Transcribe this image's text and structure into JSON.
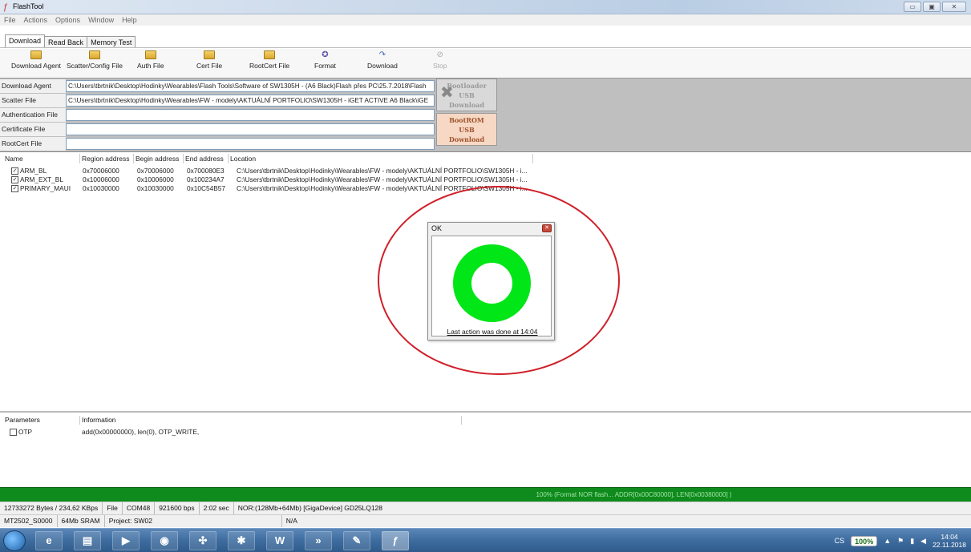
{
  "window": {
    "title": "FlashTool"
  },
  "menu": [
    "File",
    "Actions",
    "Options",
    "Window",
    "Help"
  ],
  "tabs": [
    "Download",
    "Read Back",
    "Memory Test"
  ],
  "toolbar": {
    "download_agent": "Download Agent",
    "scatter": "Scatter/Config File",
    "auth": "Auth File",
    "cert": "Cert File",
    "rootcert": "RootCert File",
    "format": "Format",
    "download": "Download",
    "stop": "Stop"
  },
  "files": {
    "download_agent_label": "Download Agent",
    "download_agent_value": "C:\\Users\\tbrtnik\\Desktop\\Hodinky\\Wearables\\Flash Tools\\Software of SW1305H - (A6 Black)Flash přes PC\\25.7.2018\\Flash",
    "scatter_label": "Scatter File",
    "scatter_value": "C:\\Users\\tbrtnik\\Desktop\\Hodinky\\Wearables\\FW - modely\\AKTUÁLNÍ PORTFOLIO\\SW1305H - iGET ACTIVE A6 Black\\iGE",
    "auth_label": "Authentication File",
    "auth_value": "",
    "cert_label": "Certificate File",
    "cert_value": "",
    "rootcert_label": "RootCert File",
    "rootcert_value": ""
  },
  "modes": {
    "bootloader": [
      "Bootloader",
      "USB",
      "Download"
    ],
    "bootrom": [
      "BootROM",
      "USB",
      "Download"
    ]
  },
  "region_table": {
    "headers": [
      "Name",
      "Region address",
      "Begin address",
      "End address",
      "Location"
    ],
    "rows": [
      {
        "name": "ARM_BL",
        "region": "0x70006000",
        "begin": "0x70006000",
        "end": "0x700080E3",
        "location": "C:\\Users\\tbrtnik\\Desktop\\Hodinky\\Wearables\\FW - modely\\AKTUÁLNÍ PORTFOLIO\\SW1305H - i..."
      },
      {
        "name": "ARM_EXT_BL",
        "region": "0x10006000",
        "begin": "0x10006000",
        "end": "0x100234A7",
        "location": "C:\\Users\\tbrtnik\\Desktop\\Hodinky\\Wearables\\FW - modely\\AKTUÁLNÍ PORTFOLIO\\SW1305H - i..."
      },
      {
        "name": "PRIMARY_MAUI",
        "region": "0x10030000",
        "begin": "0x10030000",
        "end": "0x10C54B57",
        "location": "C:\\Users\\tbrtnik\\Desktop\\Hodinky\\Wearables\\FW - modely\\AKTUÁLNÍ PORTFOLIO\\SW1305H - i..."
      }
    ]
  },
  "dialog": {
    "title": "OK",
    "message": "Last action was done at 14:04",
    "ring_color": "#00e617"
  },
  "params": {
    "headers": [
      "Parameters",
      "Information"
    ],
    "rows": [
      {
        "name": "OTP",
        "info": "add(0x00000000), len(0), OTP_WRITE,"
      }
    ]
  },
  "progress": {
    "text": "100% (Format NOR flash... ADDR[0x00C80000], LEN[0x00380000] )",
    "percent": 100,
    "color": "#0f8a1c"
  },
  "status1": [
    "12733272 Bytes / 234,62 KBps",
    "File",
    "COM48",
    "921600 bps",
    "2:02 sec",
    "NOR:(128Mb+64Mb) [GigaDevice] GD25LQ128"
  ],
  "status2": [
    "MT2502_S0000",
    "64Mb SRAM",
    "Project: SW02",
    "N/A"
  ],
  "taskbar": {
    "apps": [
      "ie-icon",
      "explorer-icon",
      "media-player-icon",
      "chrome-icon",
      "network-icon",
      "app-red-icon",
      "word-icon",
      "app-arrows-icon",
      "app-paint-icon",
      "flashtool-icon"
    ],
    "lang": "CS",
    "battery": "100%",
    "time": "14:04",
    "date": "22.11.2018"
  }
}
